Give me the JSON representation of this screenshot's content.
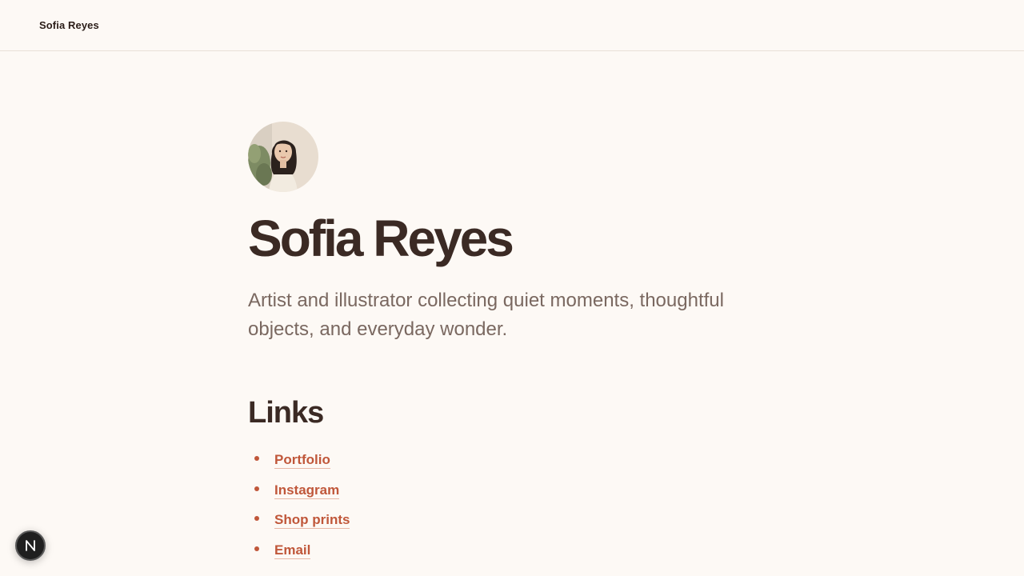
{
  "header": {
    "brand": "Sofia Reyes"
  },
  "profile": {
    "name": "Sofia Reyes",
    "tagline": "Artist and illustrator collecting quiet moments, thoughtful objects, and everyday wonder.",
    "avatar_alt": "Portrait of Sofia Reyes"
  },
  "links": {
    "heading": "Links",
    "items": [
      {
        "label": "Portfolio"
      },
      {
        "label": "Instagram"
      },
      {
        "label": "Shop prints"
      },
      {
        "label": "Email"
      }
    ]
  },
  "dev_badge": {
    "icon": "n-logo-icon"
  },
  "colors": {
    "background": "#fdf9f5",
    "text": "#3b2a24",
    "muted": "#7a6860",
    "accent": "#c0573a"
  }
}
